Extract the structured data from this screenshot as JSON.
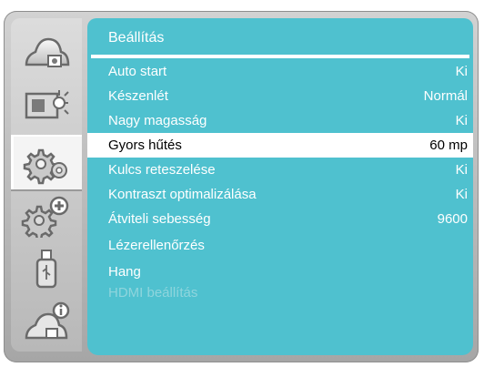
{
  "sidebar": {
    "items": [
      {
        "icon": "image-adjust-icon"
      },
      {
        "icon": "display-icon"
      },
      {
        "icon": "settings-gears-icon"
      },
      {
        "icon": "extended-settings-icon"
      },
      {
        "icon": "usb-icon"
      },
      {
        "icon": "info-icon"
      }
    ]
  },
  "menu": {
    "title": "Beállítás",
    "items": [
      {
        "label": "Auto start",
        "value": "Ki"
      },
      {
        "label": "Készenlét",
        "value": "Normál"
      },
      {
        "label": "Nagy magasság",
        "value": "Ki"
      },
      {
        "label": "Gyors hűtés",
        "value": "60 mp"
      },
      {
        "label": "Kulcs reteszelése",
        "value": "Ki"
      },
      {
        "label": "Kontraszt optimalizálása",
        "value": "Ki"
      },
      {
        "label": "Átviteli sebesség",
        "value": "9600"
      },
      {
        "label": "Lézerellenőrzés",
        "value": ""
      },
      {
        "label": "Hang",
        "value": ""
      },
      {
        "label": "HDMI beállítás",
        "value": ""
      }
    ]
  },
  "colors": {
    "panel": "#4fc1cf",
    "selected_row": "#ffffff",
    "disabled_text": "#8fd5dd"
  }
}
